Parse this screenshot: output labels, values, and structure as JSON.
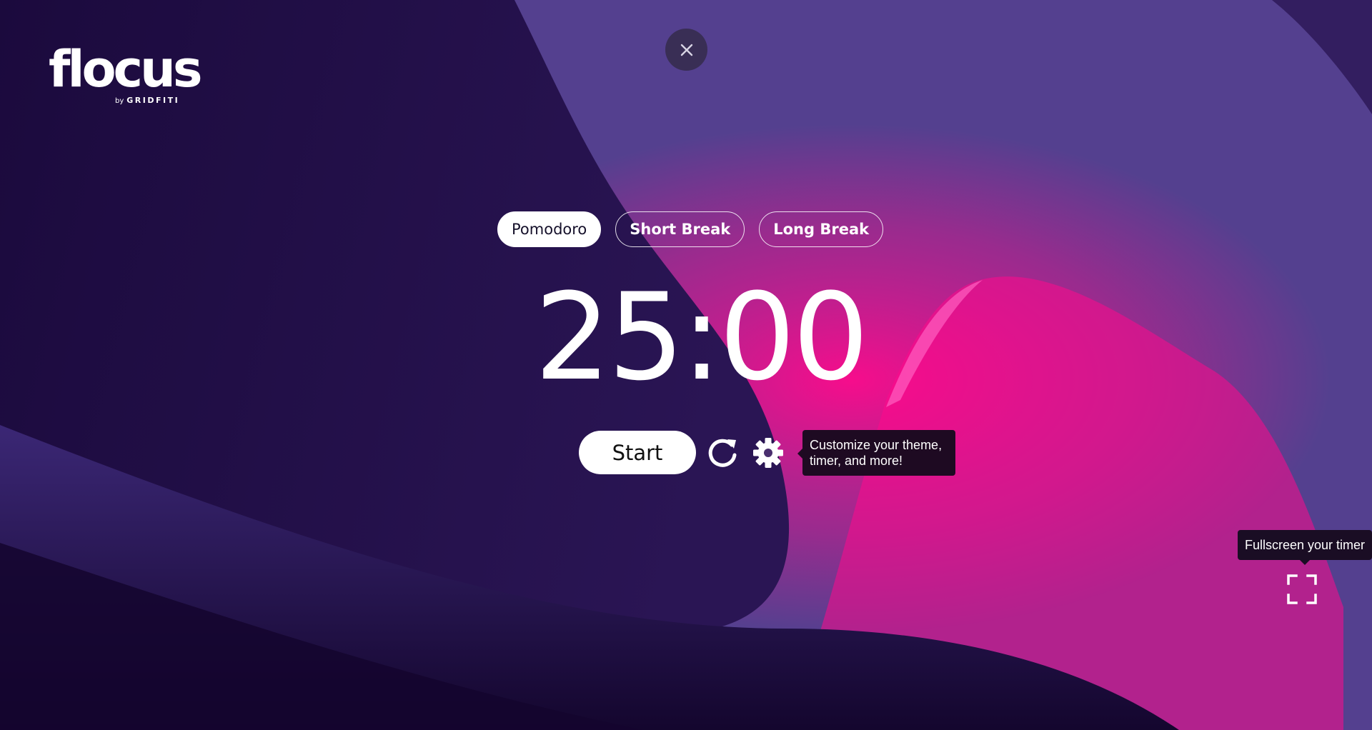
{
  "app": {
    "logo_text": "flocus",
    "logo_by": "by",
    "logo_brand": "GRIDFITI"
  },
  "modes": [
    {
      "label": "Pomodoro",
      "active": true
    },
    {
      "label": "Short Break",
      "active": false
    },
    {
      "label": "Long Break",
      "active": false
    }
  ],
  "timer": {
    "display": "25:00"
  },
  "controls": {
    "start_label": "Start",
    "reset_icon": "reset-icon",
    "settings_icon": "gear-icon"
  },
  "tooltips": {
    "customize": "Customize your theme, timer, and more!",
    "fullscreen": "Fullscreen your timer"
  },
  "icons": {
    "close": "close-icon",
    "fullscreen": "fullscreen-icon"
  },
  "colors": {
    "background_dark": "#1a0838",
    "background_purple": "#54408f",
    "accent_pink": "#ff0a8c",
    "tooltip_bg": "#1e0a22"
  }
}
